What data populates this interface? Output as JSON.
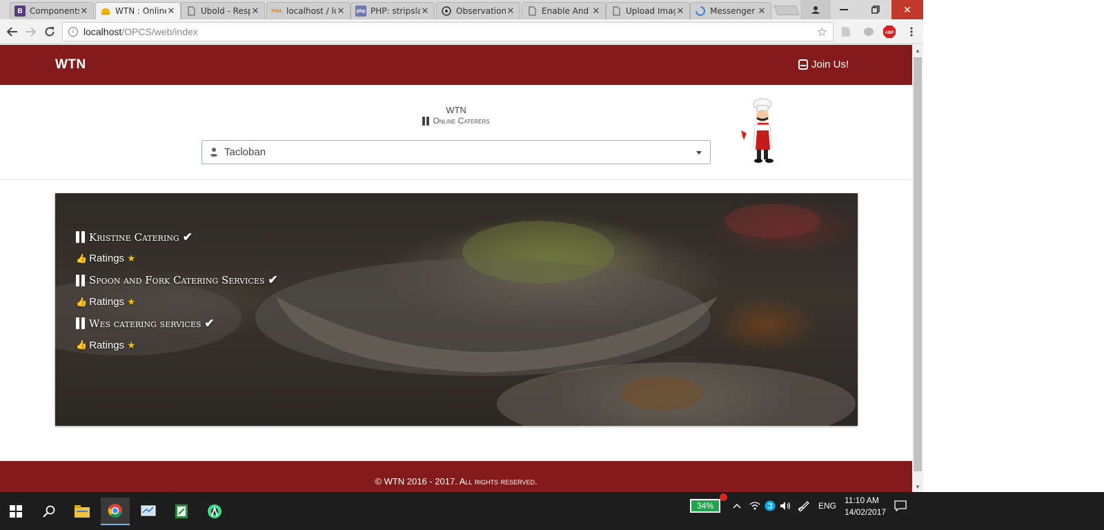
{
  "browser": {
    "tabs": [
      {
        "label": "Components",
        "favicon": "B",
        "active": false
      },
      {
        "label": "WTN : Online Caterers",
        "favicon": "hat",
        "active": true
      },
      {
        "label": "Ubold - Responsive",
        "favicon": "doc",
        "active": false
      },
      {
        "label": "localhost / localhost",
        "favicon": "pma",
        "active": false
      },
      {
        "label": "PHP: stripslashes",
        "favicon": "php",
        "active": false
      },
      {
        "label": "Observation",
        "favicon": "eye",
        "active": false
      },
      {
        "label": "Enable And",
        "favicon": "doc",
        "active": false
      },
      {
        "label": "Upload Image",
        "favicon": "doc",
        "active": false
      },
      {
        "label": "Messenger",
        "favicon": "spinner",
        "active": false
      }
    ],
    "close_glyph": "✕",
    "url_host": "localhost",
    "url_path": "/OPCS/web/index",
    "info_glyph": "i",
    "abp_label": "ABP"
  },
  "site": {
    "brand": "WTN",
    "join_label": "Join Us!",
    "site_name": "WTN",
    "tagline": "Online Caterers",
    "city_value": "Tacloban",
    "caterers": [
      {
        "name": "Kristine Catering",
        "rating_label": "Ratings"
      },
      {
        "name": "Spoon and Fork Catering Services",
        "rating_label": "Ratings"
      },
      {
        "name": "Wes catering services",
        "rating_label": "Ratings"
      }
    ],
    "footer": "© WTN 2016 - 2017. All rights reserved."
  },
  "taskbar": {
    "battery_percent": "34%",
    "language": "ENG",
    "time": "11:10 AM",
    "date": "14/02/2017"
  },
  "colors": {
    "brand_red": "#841b1b",
    "select_border": "#8fb4e5",
    "thumb": "#e81c1c",
    "star": "#f2c200",
    "battery": "#22a34d"
  }
}
